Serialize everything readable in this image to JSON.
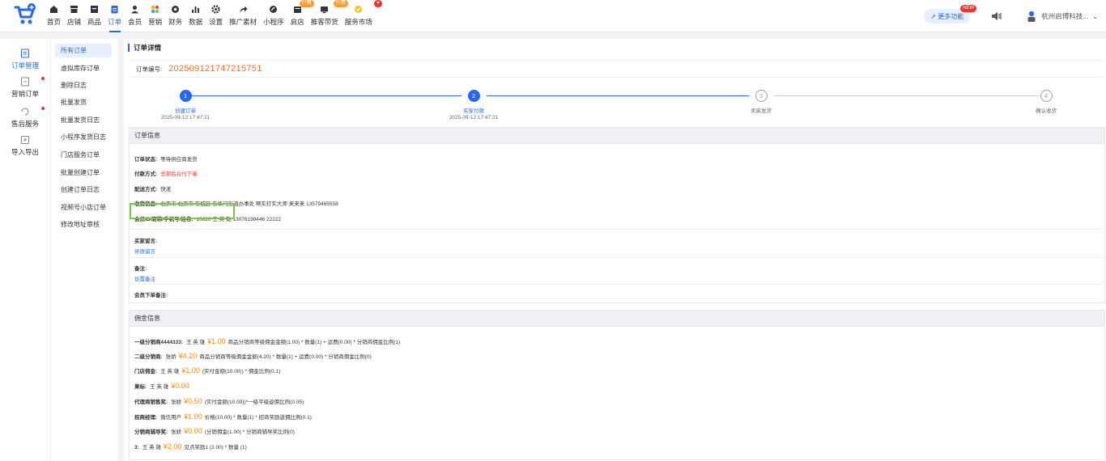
{
  "nav": [
    {
      "label": "首页",
      "icon": "home-icon"
    },
    {
      "label": "店铺",
      "icon": "store-icon"
    },
    {
      "label": "商品",
      "icon": "goods-icon"
    },
    {
      "label": "订单",
      "icon": "order-icon",
      "active": true
    },
    {
      "label": "会员",
      "icon": "member-icon"
    },
    {
      "label": "营销",
      "icon": "marketing-icon"
    },
    {
      "label": "财务",
      "icon": "finance-icon"
    },
    {
      "label": "数据",
      "icon": "chart-icon"
    },
    {
      "label": "设置",
      "icon": "gear-icon"
    },
    {
      "label": "推广素材",
      "icon": "share-icon"
    },
    {
      "label": "小程序",
      "icon": "miniapp-icon"
    },
    {
      "label": "启店",
      "icon": "open-store-icon",
      "badge": "付费"
    },
    {
      "label": "推客带货",
      "icon": "promoter-icon",
      "badge": "付费"
    },
    {
      "label": "服务市场",
      "icon": "service-market-icon",
      "badge": "♥"
    }
  ],
  "top_right": {
    "more_label": "更多功能",
    "more_badge": "NEW",
    "company": "杭州启博科技..."
  },
  "rail": [
    {
      "label": "订单管理",
      "icon": "order-manage-icon",
      "active": true
    },
    {
      "label": "营销订单",
      "icon": "marketing-order-icon",
      "dot": true
    },
    {
      "label": "售后服务",
      "icon": "after-sale-icon",
      "dot": true
    },
    {
      "label": "导入导出",
      "icon": "import-export-icon"
    }
  ],
  "submenu": [
    {
      "label": "所有订单",
      "active": true
    },
    {
      "label": "虚拟库存订单"
    },
    {
      "label": "删除日志"
    },
    {
      "label": "批量发货"
    },
    {
      "label": "批量发货日志"
    },
    {
      "label": "小程序发货日志"
    },
    {
      "label": "门店服务订单"
    },
    {
      "label": "批量创建订单"
    },
    {
      "label": "创建订单日志"
    },
    {
      "label": "视频号小店订单"
    },
    {
      "label": "修改地址审核"
    }
  ],
  "page_title": "订单详情",
  "order_no": {
    "label": "订单编号:",
    "value": "202509121747215751"
  },
  "steps": [
    {
      "num": "1",
      "name": "创建订单",
      "time": "2025-09-12 17:47:21",
      "done": true
    },
    {
      "num": "2",
      "name": "买家付款",
      "time": "2025-09-12 17:47:21",
      "done": true
    },
    {
      "num": "3",
      "name": "卖家发货",
      "time": "",
      "done": false
    },
    {
      "num": "4",
      "name": "确认收货",
      "time": "",
      "done": false
    }
  ],
  "order_info": {
    "head": "订单信息",
    "status": {
      "k": "订单状态:",
      "v": "等待供应商发货"
    },
    "pay": {
      "k": "付款方式:",
      "v": "总部后台代下单"
    },
    "ship": {
      "k": "配送方式:",
      "v": "快递"
    },
    "receiver": {
      "k": "收货信息:",
      "v": "北京市 北京市 东城区 东华门街道办事处 啊实打实大师   来来来   13579465558"
    },
    "member": {
      "k": "会员ID/昵称/手机号/姓名:",
      "v": "10820  王 英 雄   13076198446  22222"
    },
    "buyer_msg": {
      "k": "买家留言:",
      "link": "修改留言"
    },
    "remark": {
      "k": "备注:",
      "link": "设置备注"
    },
    "member_remark": {
      "k": "会员下单备注:"
    }
  },
  "commission": {
    "head": "佣金信息",
    "rows": [
      {
        "k": "一级分销商4444333:",
        "who": "王 英 雄",
        "amt": "¥1.00",
        "desc": "商品分销商等级佣金金额(1.00) * 数量(1) + 运费(0.00) * 分销商佣金比例(1)"
      },
      {
        "k": "二级分销商:",
        "who": "张娇",
        "amt": "¥4.20",
        "desc": "商品分销商等级佣金金额(4.20) * 数量(1) + 运费(0.00) * 分销商佣金比例(0)"
      },
      {
        "k": "门店佣金:",
        "who": "王 英 雄",
        "amt": "¥1.00",
        "desc": "(实付金额(10.00)) * 佣金比例(0.1)"
      },
      {
        "k": "果标:",
        "who": "王 英 雄",
        "amt": "¥0.00",
        "desc": ""
      },
      {
        "k": "代理商销售奖:",
        "who": "张娇",
        "amt": "¥0.50",
        "desc": "(实付金额(10.00))*一级平级返佣比例(0.05)"
      },
      {
        "k": "招商经理:",
        "who": "微信用户",
        "amt": "¥1.00",
        "desc": "价格(10.00) * 数量(1) * 招商奖励返佣比例(0.1)"
      },
      {
        "k": "分销商辅导奖:",
        "who": "张娇",
        "amt": "¥0.00",
        "desc": "(分销佣金(1.00) * 分销商辅导奖比例(0)"
      },
      {
        "k": "3:",
        "who": "王 英 雄",
        "amt": "¥2.00",
        "desc": "见点奖励1 (2.00) * 数量 (1)"
      }
    ]
  },
  "colors": {
    "accent": "#2468f2",
    "amount": "#ff8a00",
    "order_no": "#ff6a1a",
    "danger": "#f5302b",
    "highlight": "#7ac943"
  }
}
